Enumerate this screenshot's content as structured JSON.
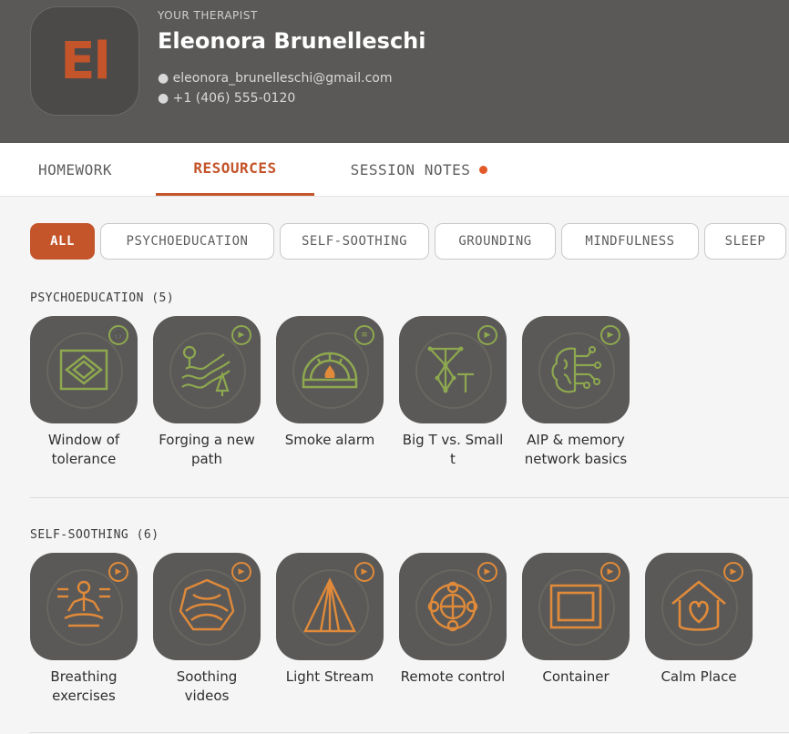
{
  "therapist": {
    "kicker": "YOUR THERAPIST",
    "initials": "El",
    "name": "Eleonora Brunelleschi",
    "email": "● eleonora_brunelleschi@gmail.com",
    "phone": "● +1 (406) 555-0120"
  },
  "tabs": [
    {
      "label": "HOMEWORK"
    },
    {
      "label": "RESOURCES",
      "active": true
    },
    {
      "label": "SESSION NOTES",
      "has_notification": true
    }
  ],
  "filters": [
    {
      "label": "ALL",
      "active": true
    },
    {
      "label": "PSYCHOEDUCATION"
    },
    {
      "label": "SELF-SOOTHING"
    },
    {
      "label": "GROUNDING"
    },
    {
      "label": "MINDFULNESS"
    },
    {
      "label": "SLEEP"
    }
  ],
  "sections": [
    {
      "title": "PSYCHOEDUCATION (5)",
      "items": [
        {
          "label": "Window of tolerance",
          "type_icon": "headphones-icon"
        },
        {
          "label": "Forging a new path",
          "type_icon": "play-icon"
        },
        {
          "label": "Smoke alarm",
          "type_icon": "text-icon"
        },
        {
          "label": "Big T vs. Small t",
          "type_icon": "play-icon"
        },
        {
          "label": "AIP & memory network basics",
          "type_icon": "play-icon"
        }
      ]
    },
    {
      "title": "SELF-SOOTHING (6)",
      "items": [
        {
          "label": "Breathing exercises",
          "type_icon": "play-icon"
        },
        {
          "label": "Soothing videos",
          "type_icon": "play-icon"
        },
        {
          "label": "Light Stream",
          "type_icon": "play-icon"
        },
        {
          "label": "Remote control",
          "type_icon": "play-icon"
        },
        {
          "label": "Container",
          "type_icon": "play-icon"
        },
        {
          "label": "Calm Place",
          "type_icon": "play-icon"
        }
      ]
    }
  ],
  "colors": {
    "accent": "#c4542a",
    "header_bg": "#5a5957",
    "psychoeducation_icon": "#8ea84f",
    "self_soothing_icon": "#e08a3a"
  }
}
